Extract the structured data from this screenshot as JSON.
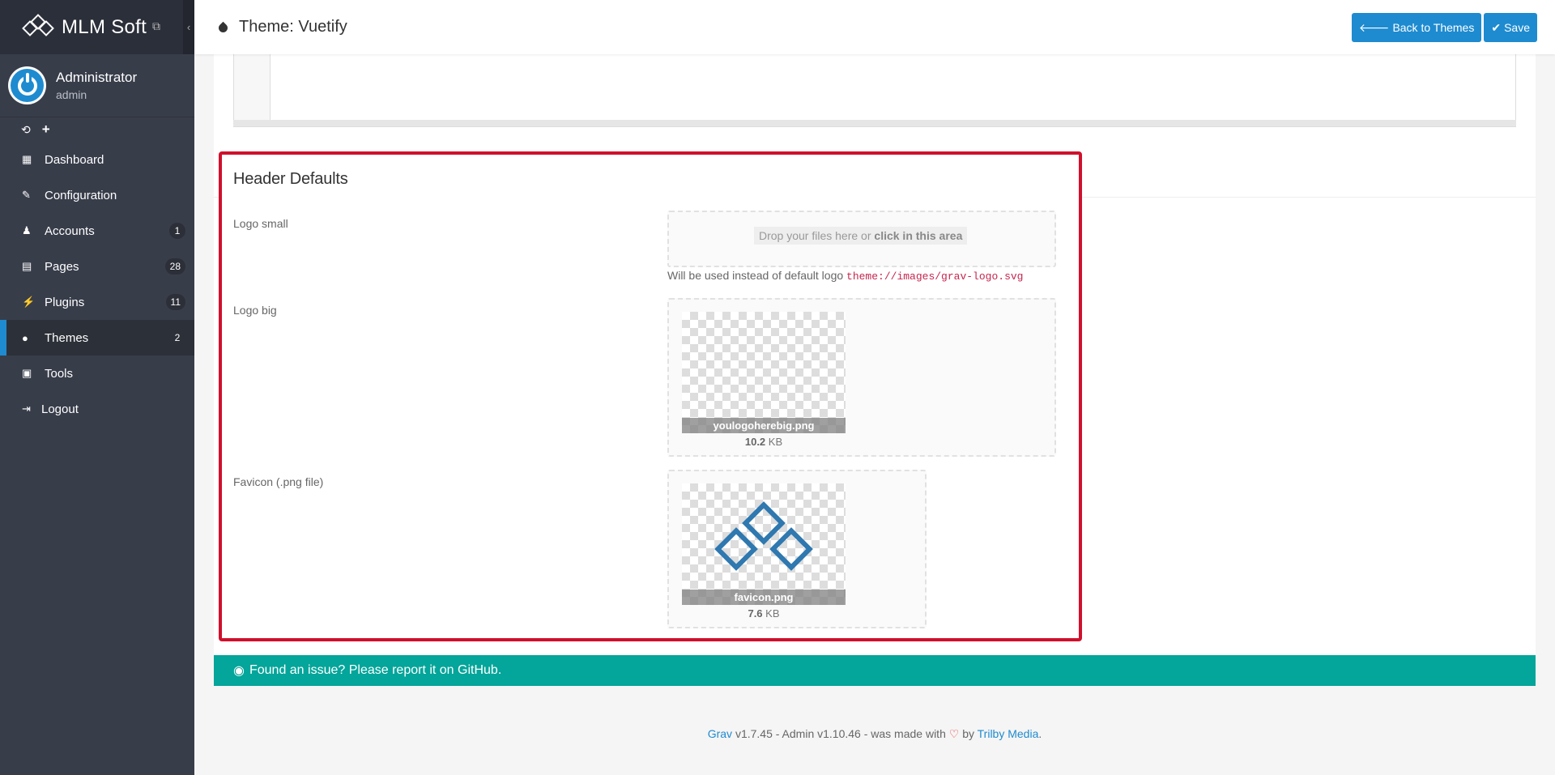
{
  "brand": {
    "name": "MLM Soft",
    "ext_icon": "external-link-icon",
    "collapse_icon": "chevron-left-icon"
  },
  "user": {
    "name": "Administrator",
    "role": "admin"
  },
  "quick_actions": {
    "refresh": "⟲",
    "add": "+"
  },
  "nav": [
    {
      "label": "Dashboard",
      "icon": "dashboard-icon",
      "badge": ""
    },
    {
      "label": "Configuration",
      "icon": "wrench-icon",
      "badge": ""
    },
    {
      "label": "Accounts",
      "icon": "users-icon",
      "badge": "1"
    },
    {
      "label": "Pages",
      "icon": "file-icon",
      "badge": "28"
    },
    {
      "label": "Plugins",
      "icon": "plug-icon",
      "badge": "11"
    },
    {
      "label": "Themes",
      "icon": "drop-icon",
      "badge": "2"
    },
    {
      "label": "Tools",
      "icon": "briefcase-icon",
      "badge": ""
    },
    {
      "label": "Logout",
      "icon": "sign-out-icon",
      "badge": ""
    }
  ],
  "header": {
    "title": "Theme: Vuetify",
    "back_label": "Back to Themes",
    "save_label": "Save"
  },
  "section": {
    "title": "Header Defaults",
    "logo_small": {
      "label": "Logo small",
      "drop_text": "Drop your files here or ",
      "drop_bold": "click in this area",
      "help_text": "Will be used instead of default logo ",
      "help_code": "theme://images/grav-logo.svg"
    },
    "logo_big": {
      "label": "Logo big",
      "file_name": "youlogoherebig.png",
      "file_size": "10.2",
      "size_unit": " KB"
    },
    "favicon": {
      "label": "Favicon (.png file)",
      "file_name": "favicon.png",
      "file_size": "7.6",
      "size_unit": " KB"
    }
  },
  "footer": {
    "issue_text": "Found an issue? Please report it on GitHub.",
    "grav": "Grav",
    "mid_text": " v1.7.45 - Admin v1.10.46 - was made with ",
    "by_text": " by ",
    "trilby": "Trilby Media",
    "end": "."
  },
  "colors": {
    "accent": "#1e8bd0",
    "sidebar": "#383d4a",
    "highlight": "#d0102c",
    "footer_bar": "#04a59a"
  }
}
